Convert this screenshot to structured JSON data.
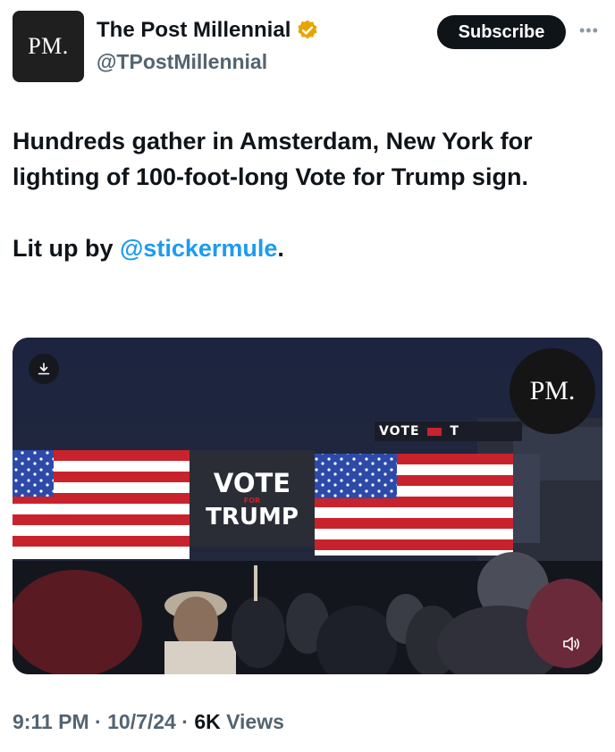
{
  "account": {
    "avatar_text": "PM.",
    "display_name": "The Post Millennial",
    "handle": "@TPostMillennial",
    "verified_color": "#e8a400"
  },
  "header": {
    "subscribe_label": "Subscribe",
    "more_icon": "more-dots-icon"
  },
  "tweet": {
    "line1": "Hundreds gather in Amsterdam, New York for lighting of 100-foot-long Vote for Trump sign.",
    "line2_prefix": "Lit up by ",
    "mention": "@stickermule",
    "line2_suffix": "."
  },
  "media": {
    "watermark": "PM.",
    "sign_top": "VOTE",
    "sign_small": "FOR",
    "sign_bottom": "TRUMP",
    "far_sign": "VOTE",
    "far_sign_letter": "T",
    "download_icon": "download-icon",
    "mute_icon": "speaker-icon"
  },
  "footer": {
    "time": "9:11 PM",
    "sep1": " · ",
    "date": "10/7/24",
    "sep2": " · ",
    "views_count": "6K",
    "views_label": " Views"
  },
  "colors": {
    "accent": "#1d9bf0",
    "text": "#0f1419",
    "muted": "#536471"
  }
}
